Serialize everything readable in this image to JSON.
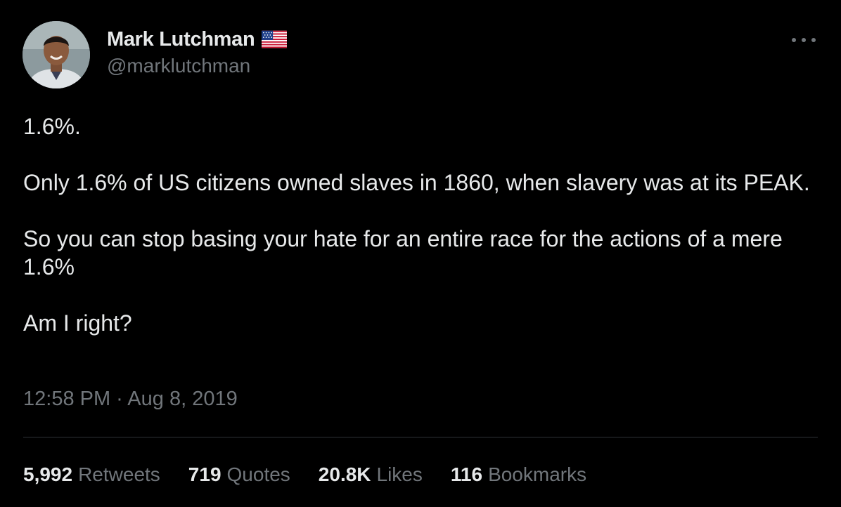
{
  "author": {
    "name": "Mark Lutchman",
    "handle": "@marklutchman",
    "flag_icon": "us-flag-icon"
  },
  "tweet": {
    "paragraphs": [
      "1.6%.",
      "Only 1.6% of US citizens owned slaves in 1860, when slavery was at its PEAK.",
      "So you can stop basing your hate for an entire race for the actions of a mere 1.6%",
      "Am I right?"
    ],
    "timestamp": "12:58 PM · Aug 8, 2019"
  },
  "stats": {
    "retweets": {
      "count": "5,992",
      "label": "Retweets"
    },
    "quotes": {
      "count": "719",
      "label": "Quotes"
    },
    "likes": {
      "count": "20.8K",
      "label": "Likes"
    },
    "bookmarks": {
      "count": "116",
      "label": "Bookmarks"
    }
  },
  "menu": {
    "icon": "more-options-icon"
  },
  "colors": {
    "background": "#000000",
    "primary_text": "#e7e9ea",
    "secondary_text": "#71767b",
    "divider": "#2f3336"
  }
}
